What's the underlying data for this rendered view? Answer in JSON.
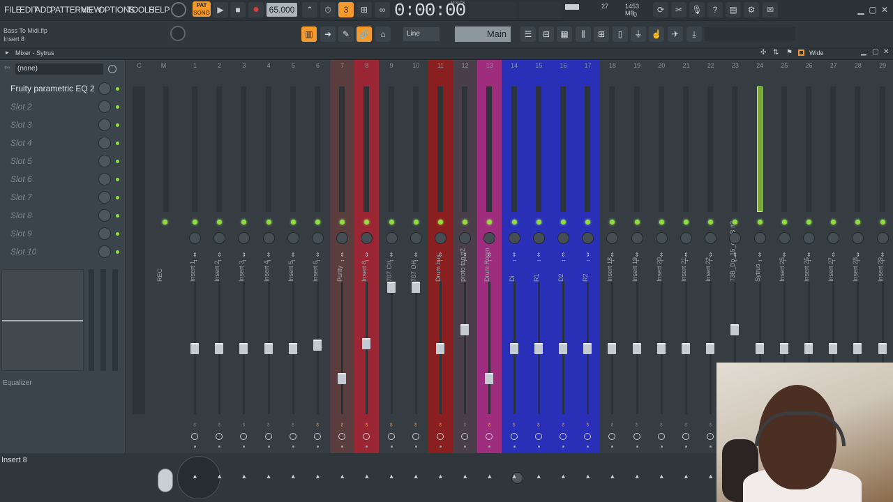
{
  "menu": [
    "FILE",
    "EDIT",
    "ADD",
    "PATTERNS",
    "VIEW",
    "OPTIONS",
    "TOOLS",
    "HELP"
  ],
  "transport": {
    "pat_label": "PAT",
    "song_label": "SONG",
    "tempo": "65.000",
    "time": "0:00:00",
    "time_unit": "M:S:CS",
    "cpu_value": "27",
    "mem_value": "1453 MB",
    "poly_value": "0"
  },
  "song": {
    "file": "Bass To Midi.flp",
    "selected": "Insert 8"
  },
  "toolbar2": {
    "snap": "Line",
    "pattern_selector": "Main"
  },
  "mixer": {
    "title": "Mixer - Sytrus",
    "view_mode": "Wide",
    "preset": "(none)",
    "slots": [
      {
        "label": "Fruity parametric EQ 2",
        "active": true
      },
      {
        "label": "Slot 2",
        "active": false
      },
      {
        "label": "Slot 3",
        "active": false
      },
      {
        "label": "Slot 4",
        "active": false
      },
      {
        "label": "Slot 5",
        "active": false
      },
      {
        "label": "Slot 6",
        "active": false
      },
      {
        "label": "Slot 7",
        "active": false
      },
      {
        "label": "Slot 8",
        "active": false
      },
      {
        "label": "Slot 9",
        "active": false
      },
      {
        "label": "Slot 10",
        "active": false
      }
    ],
    "eq_label": "Equalizer",
    "master": {
      "num_c": "C",
      "num_m": "M",
      "name": "REC"
    },
    "tracks": [
      {
        "num": "1",
        "name": "Insert 1",
        "color": "#353d43",
        "fx": false,
        "fader": 0.49
      },
      {
        "num": "2",
        "name": "Insert 2",
        "color": "#353d43",
        "fx": false,
        "fader": 0.49
      },
      {
        "num": "3",
        "name": "Insert 3",
        "color": "#353d43",
        "fx": false,
        "fader": 0.49
      },
      {
        "num": "4",
        "name": "Insert 4",
        "color": "#353d43",
        "fx": false,
        "fader": 0.49
      },
      {
        "num": "5",
        "name": "Insert 5",
        "color": "#353d43",
        "fx": false,
        "fader": 0.49
      },
      {
        "num": "6",
        "name": "Insert 6",
        "color": "#353d43",
        "fx": true,
        "fader": 0.46
      },
      {
        "num": "7",
        "name": "Purity",
        "color": "#5a3d3d",
        "fx": true,
        "fader": 0.73
      },
      {
        "num": "8",
        "name": "Insert 8",
        "color": "#9a2634",
        "fx": true,
        "fader": 0.45
      },
      {
        "num": "9",
        "name": "707 CH",
        "color": "#353d43",
        "fx": true,
        "fader": 0.0
      },
      {
        "num": "10",
        "name": "707 OH",
        "color": "#353d43",
        "fx": true,
        "fader": 0.0
      },
      {
        "num": "11",
        "name": "Drum bus",
        "color": "#8a1f1f",
        "fx": true,
        "fader": 0.49
      },
      {
        "num": "12",
        "name": "proto tag #2",
        "color": "#4a3f48",
        "fx": false,
        "fader": 0.34
      },
      {
        "num": "13",
        "name": "Drum Room",
        "color": "#9e2d7e",
        "fx": true,
        "fader": 0.73
      },
      {
        "num": "14",
        "name": "Di",
        "color": "#2a2fb8",
        "fx": true,
        "fader": 0.49
      },
      {
        "num": "15",
        "name": "R1",
        "color": "#2a2fb8",
        "fx": true,
        "fader": 0.49
      },
      {
        "num": "16",
        "name": "D2",
        "color": "#2a2fb8",
        "fx": true,
        "fader": 0.49
      },
      {
        "num": "17",
        "name": "R2",
        "color": "#2a2fb8",
        "fx": true,
        "fader": 0.49
      },
      {
        "num": "18",
        "name": "Insert 18",
        "color": "#353d43",
        "fx": false,
        "fader": 0.49
      },
      {
        "num": "19",
        "name": "Insert 19",
        "color": "#353d43",
        "fx": false,
        "fader": 0.49
      },
      {
        "num": "20",
        "name": "Insert 20",
        "color": "#353d43",
        "fx": false,
        "fader": 0.49
      },
      {
        "num": "21",
        "name": "Insert 21",
        "color": "#353d43",
        "fx": false,
        "fader": 0.49
      },
      {
        "num": "22",
        "name": "Insert 22",
        "color": "#353d43",
        "fx": false,
        "fader": 0.49
      },
      {
        "num": "23",
        "name": "73B_Dp_15_eLAB #2",
        "color": "#353d43",
        "fx": false,
        "fader": 0.34
      },
      {
        "num": "24",
        "name": "Sytrus",
        "color": "#353d43",
        "fx": false,
        "fader": 0.49
      },
      {
        "num": "25",
        "name": "Insert 25",
        "color": "#353d43",
        "fx": false,
        "fader": 0.49
      },
      {
        "num": "26",
        "name": "Insert 26",
        "color": "#353d43",
        "fx": false,
        "fader": 0.49
      },
      {
        "num": "27",
        "name": "Insert 27",
        "color": "#353d43",
        "fx": false,
        "fader": 0.49
      },
      {
        "num": "28",
        "name": "Insert 28",
        "color": "#353d43",
        "fx": false,
        "fader": 0.49
      },
      {
        "num": "29",
        "name": "Insert 29",
        "color": "#353d43",
        "fx": false,
        "fader": 0.49
      }
    ]
  },
  "hint": "Insert 8"
}
